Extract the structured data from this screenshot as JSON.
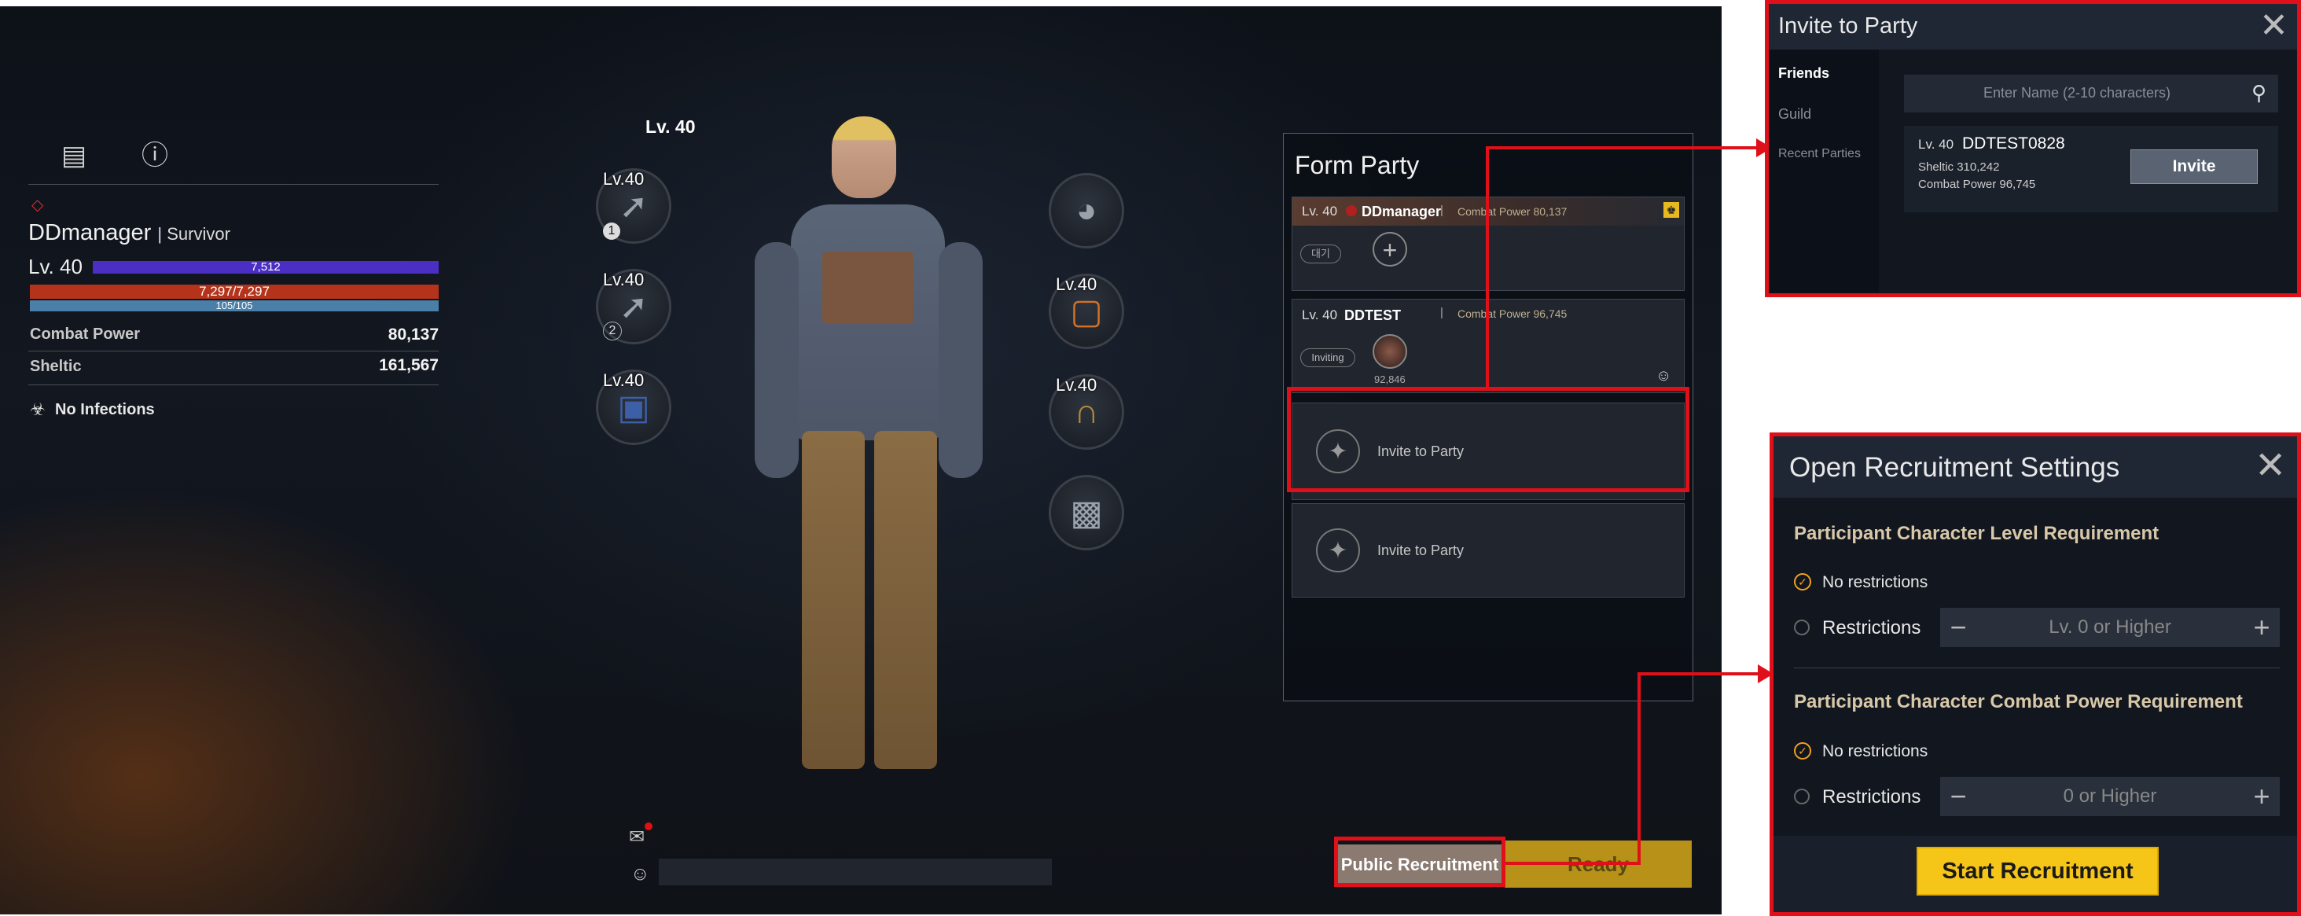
{
  "character": {
    "name": "DDmanager",
    "class": "Survivor",
    "level": "Lv. 40",
    "exp_bar": "7,512",
    "hp_bar": "7,297/7,297",
    "stamina_bar": "105/105",
    "combat_power_label": "Combat Power",
    "combat_power_value": "80,137",
    "sheltic_label": "Sheltic",
    "sheltic_value": "161,567",
    "infection_label": "No Infections",
    "equip_level_header": "Lv. 40"
  },
  "equipment": {
    "slot_level": "Lv.40",
    "rifle_count": "1",
    "shotgun_count": "2"
  },
  "party": {
    "title": "Form Party",
    "member1": {
      "level": "Lv. 40",
      "name": "DDmanager",
      "cp": "Combat Power 80,137",
      "status": "대기"
    },
    "member2": {
      "level": "Lv. 40",
      "name": "DDTEST",
      "cp": "Combat Power 96,745",
      "status": "Inviting",
      "sub": "92,846"
    },
    "invite_slot1": "Invite to Party",
    "invite_slot2": "Invite to Party"
  },
  "buttons": {
    "public_recruitment": "Public Recruitment",
    "ready": "Ready"
  },
  "invite_popup": {
    "title": "Invite to Party",
    "tabs": [
      "Friends",
      "Guild",
      "Recent Parties"
    ],
    "search_placeholder": "Enter Name (2-10 characters)",
    "result": {
      "level": "Lv. 40",
      "name": "DDTEST0828",
      "sheltic": "Sheltic 310,242",
      "cp": "Combat Power 96,745",
      "invite_button": "Invite"
    }
  },
  "recruit_popup": {
    "title": "Open Recruitment Settings",
    "level_section": "Participant Character Level Requirement",
    "cp_section": "Participant Character Combat Power Requirement",
    "no_restrictions": "No restrictions",
    "restrictions": "Restrictions",
    "level_value": "Lv. 0 or Higher",
    "cp_value": "0 or Higher",
    "start_button": "Start Recruitment"
  },
  "colors": {
    "highlight_red": "#e0101a",
    "start_button": "#f5c518",
    "exp_bar": "#4b2fc4",
    "hp_bar": "#b5331a",
    "stamina_bar": "#4a7fa8"
  }
}
